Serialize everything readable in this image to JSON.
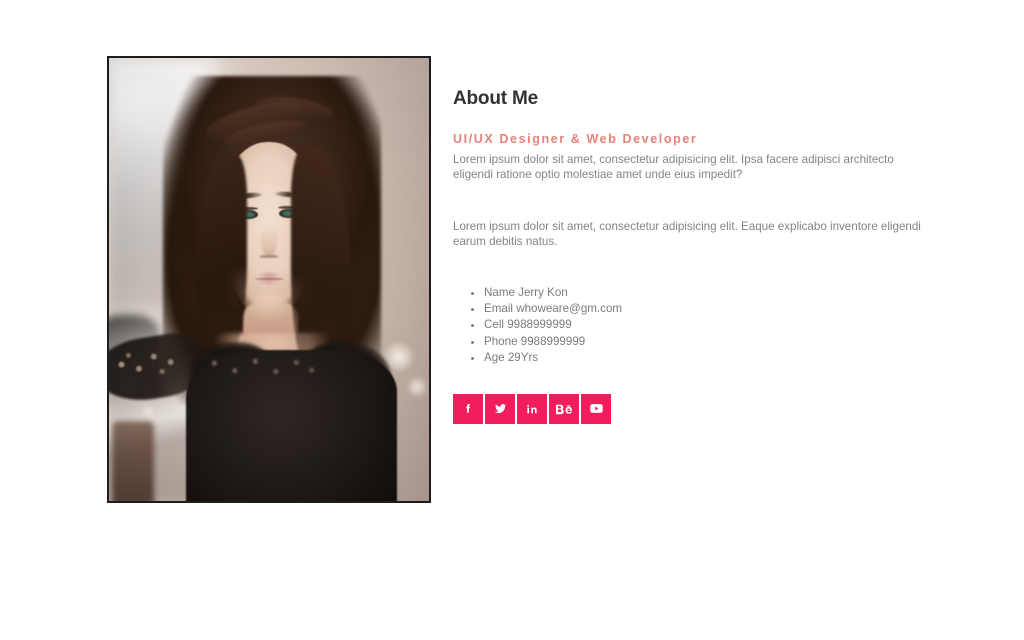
{
  "section": {
    "title": "About Me",
    "subtitle": "UI/UX Designer & Web Developer",
    "paragraphs": [
      "Lorem ipsum dolor sit amet, consectetur adipisicing elit. Ipsa facere adipisci architecto eligendi ratione optio molestiae amet unde eius impedit?",
      "Lorem ipsum dolor sit amet, consectetur adipisicing elit. Eaque explicabo inventore eligendi earum debitis natus."
    ],
    "info": [
      "Name Jerry Kon",
      "Email whoweare@gm.com",
      "Cell 9988999999",
      "Phone 9988999999",
      "Age 29Yrs"
    ],
    "social": [
      {
        "name": "facebook",
        "icon": "facebook-icon",
        "label": "f"
      },
      {
        "name": "twitter",
        "icon": "twitter-icon",
        "label": "t"
      },
      {
        "name": "linkedin",
        "icon": "linkedin-icon",
        "label": "in"
      },
      {
        "name": "behance",
        "icon": "behance-icon",
        "label": "Bē"
      },
      {
        "name": "youtube",
        "icon": "youtube-icon",
        "label": "yt"
      }
    ],
    "photo": {
      "alt": "portrait-photo",
      "frame_color": "#1d1d1d"
    }
  },
  "colors": {
    "background": "#ffffff",
    "heading": "#323232",
    "accent_subtitle": "#e8817a",
    "accent_social": "#f21d5c",
    "body_text": "#848484"
  }
}
